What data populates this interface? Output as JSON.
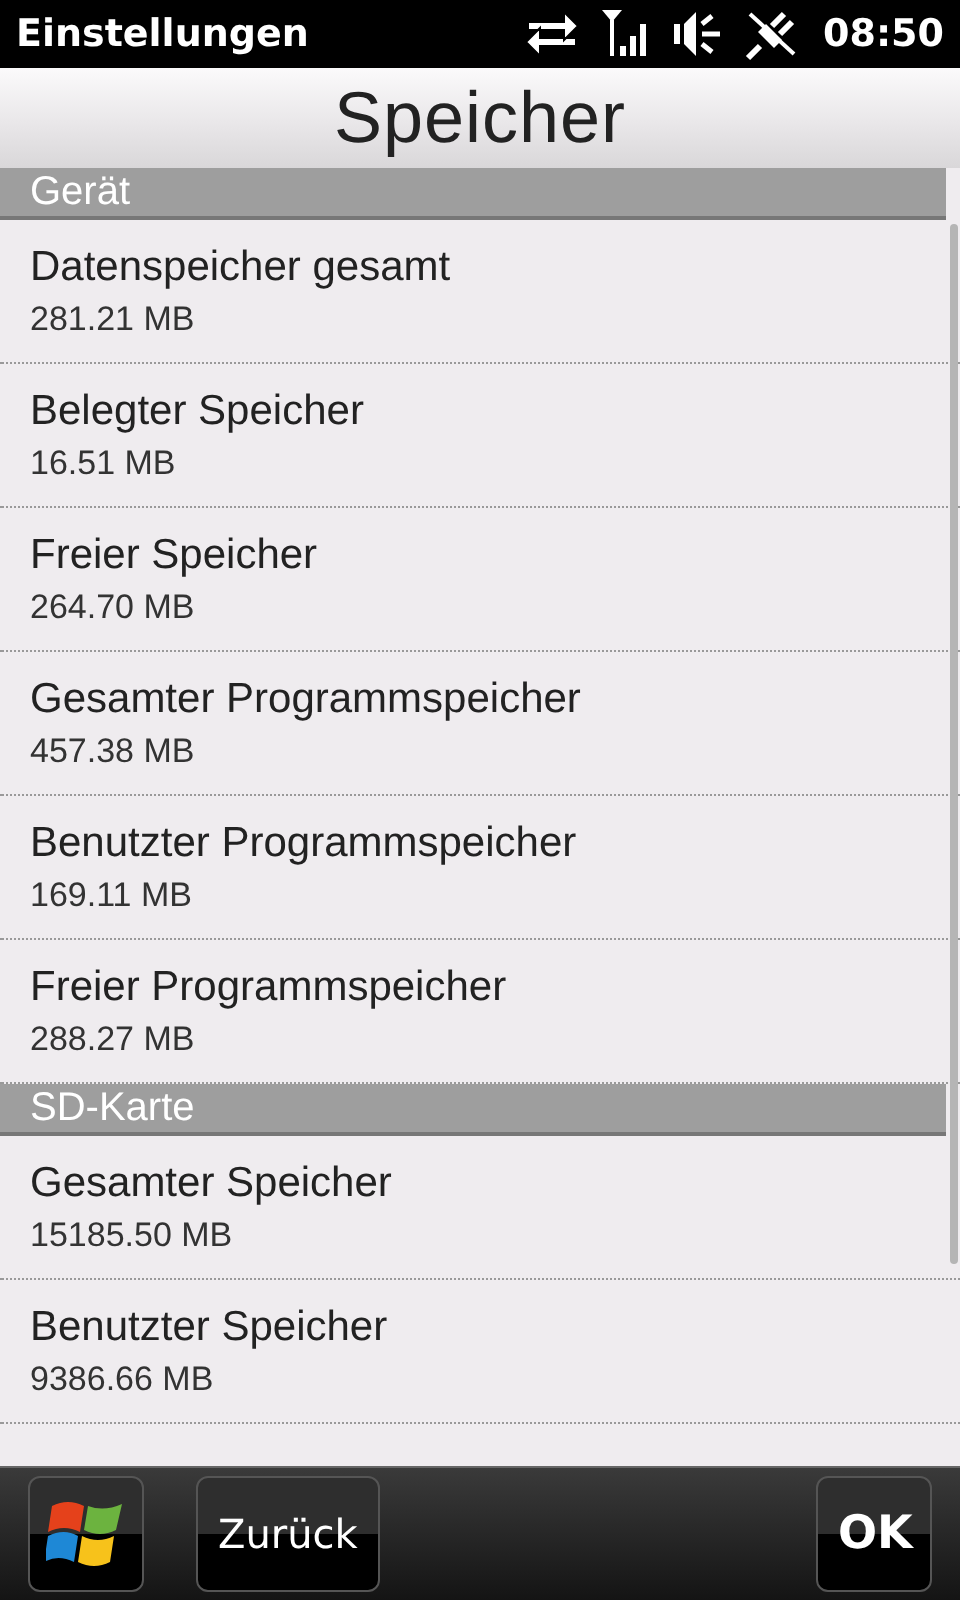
{
  "status_bar": {
    "title": "Einstellungen",
    "time": "08:50"
  },
  "page_title": "Speicher",
  "sections": [
    {
      "title": "Gerät",
      "items": [
        {
          "label": "Datenspeicher gesamt",
          "value": "281.21 MB"
        },
        {
          "label": "Belegter Speicher",
          "value": "16.51 MB"
        },
        {
          "label": "Freier Speicher",
          "value": "264.70 MB"
        },
        {
          "label": "Gesamter Programmspeicher",
          "value": "457.38 MB"
        },
        {
          "label": "Benutzter Programmspeicher",
          "value": "169.11 MB"
        },
        {
          "label": "Freier Programmspeicher",
          "value": "288.27 MB"
        }
      ]
    },
    {
      "title": "SD-Karte",
      "items": [
        {
          "label": "Gesamter Speicher",
          "value": "15185.50 MB"
        },
        {
          "label": "Benutzter Speicher",
          "value": "9386.66 MB"
        }
      ]
    }
  ],
  "bottom_bar": {
    "back": "Zurück",
    "ok": "OK"
  }
}
